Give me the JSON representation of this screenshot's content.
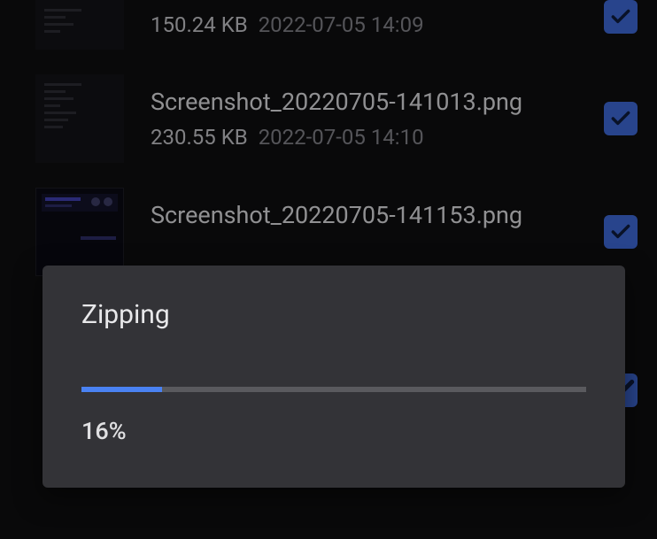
{
  "files": [
    {
      "name": "",
      "size": "150.24 KB",
      "date": "2022-07-05 14:09",
      "checked": true
    },
    {
      "name": "Screenshot_20220705-141013.png",
      "size": "230.55 KB",
      "date": "2022-07-05 14:10",
      "checked": true
    },
    {
      "name": "Screenshot_20220705-141153.png",
      "size": "",
      "date": "",
      "checked": true
    }
  ],
  "dialog": {
    "title": "Zipping",
    "percent_label": "16%",
    "percent_value": 16
  },
  "colors": {
    "accent": "#4a82f2",
    "checkbox": "#3a62c9",
    "dialog_bg": "#333337",
    "page_bg": "#0d0d0f"
  }
}
